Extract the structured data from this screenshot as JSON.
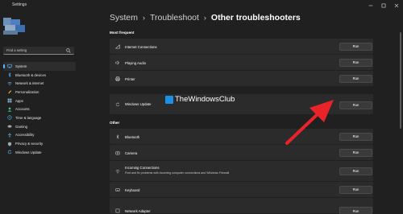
{
  "app": {
    "title": "Settings"
  },
  "sidebar": {
    "search_placeholder": "Find a setting",
    "items": [
      {
        "label": "System",
        "icon": "system-icon",
        "active": true
      },
      {
        "label": "Bluetooth & devices",
        "icon": "bluetooth-icon"
      },
      {
        "label": "Network & internet",
        "icon": "network-icon"
      },
      {
        "label": "Personalization",
        "icon": "personalization-icon"
      },
      {
        "label": "Apps",
        "icon": "apps-icon"
      },
      {
        "label": "Accounts",
        "icon": "accounts-icon"
      },
      {
        "label": "Time & language",
        "icon": "time-icon"
      },
      {
        "label": "Gaming",
        "icon": "gaming-icon"
      },
      {
        "label": "Accessibility",
        "icon": "accessibility-icon"
      },
      {
        "label": "Privacy & security",
        "icon": "privacy-icon"
      },
      {
        "label": "Windows Update",
        "icon": "windows-update-icon"
      }
    ]
  },
  "breadcrumb": {
    "level1": "System",
    "level2": "Troubleshoot",
    "current": "Other troubleshooters"
  },
  "sections": {
    "most_frequent": "Most frequent",
    "other": "Other"
  },
  "troubleshooters": {
    "internet": {
      "title": "Internet Connections",
      "icon": "wifi-icon",
      "action": "Run"
    },
    "audio": {
      "title": "Playing Audio",
      "icon": "speaker-icon",
      "action": "Run"
    },
    "printer": {
      "title": "Printer",
      "icon": "printer-icon",
      "action": "Run"
    },
    "update": {
      "title": "Windows Update",
      "icon": "refresh-icon",
      "action": "Run"
    },
    "bluetooth": {
      "title": "Bluetooth",
      "icon": "bluetooth-icon",
      "action": "Run"
    },
    "camera": {
      "title": "Camera",
      "icon": "camera-icon",
      "action": "Run"
    },
    "incoming": {
      "title": "Incoming Connections",
      "description": "Find and fix problems with incoming computer connections and Windows Firewall",
      "icon": "incoming-connections-icon",
      "action": "Run"
    },
    "keyboard": {
      "title": "Keyboard",
      "icon": "keyboard-icon",
      "action": "Run"
    },
    "network_adapter": {
      "title": "Network Adapter",
      "icon": "network-adapter-icon",
      "action": "Run"
    }
  },
  "watermark": {
    "text": "TheWindowsClub"
  },
  "colors": {
    "background": "#202020",
    "card": "#2b2b2b",
    "accent": "#4cc2ff",
    "arrow": "#e8232a"
  }
}
